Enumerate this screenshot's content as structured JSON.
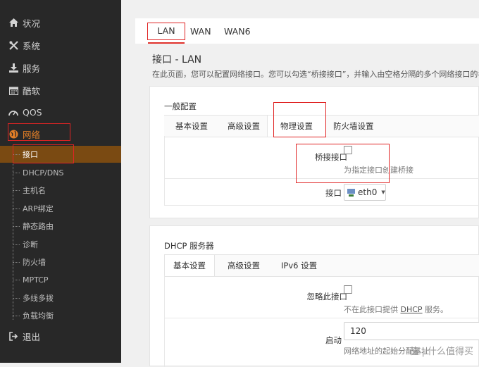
{
  "sidebar": {
    "items": [
      {
        "label": "状况",
        "icon": "home-icon"
      },
      {
        "label": "系统",
        "icon": "tools-icon"
      },
      {
        "label": "服务",
        "icon": "download-icon"
      },
      {
        "label": "酷软",
        "icon": "calendar-icon"
      },
      {
        "label": "QOS",
        "icon": "gauge-icon"
      },
      {
        "label": "网络",
        "icon": "globe-icon"
      }
    ],
    "subitems": [
      "接口",
      "DHCP/DNS",
      "主机名",
      "ARP绑定",
      "静态路由",
      "诊断",
      "防火墙",
      "MPTCP",
      "多线多拨",
      "负载均衡"
    ],
    "logout": "退出"
  },
  "top_tabs": [
    "LAN",
    "WAN",
    "WAN6"
  ],
  "section": {
    "title": "接口 - LAN",
    "description": "在此页面，您可以配置网络接口。您可以勾选“桥接接口”，并输入由空格分隔的多个网络接口的名称"
  },
  "general": {
    "title": "一般配置",
    "tabs": [
      "基本设置",
      "高级设置",
      "物理设置",
      "防火墙设置"
    ],
    "bridge_label": "桥接接口",
    "bridge_hint": "为指定接口创建桥接",
    "interface_label": "接口",
    "interface_value": "eth0"
  },
  "dhcp": {
    "title": "DHCP 服务器",
    "tabs": [
      "基本设置",
      "高级设置",
      "IPv6 设置"
    ],
    "ignore_label": "忽略此接口",
    "ignore_hint_pre": "不在此接口提供 ",
    "ignore_hint_link": "DHCP",
    "ignore_hint_post": " 服务。",
    "start_label": "启动",
    "start_value": "120",
    "start_hint": "网络地址的起始分配基址"
  },
  "watermark": "值 | 什么值得买",
  "colors": {
    "accent": "#e07e27",
    "highlight": "#e02424",
    "sidebar_bg": "#282828"
  }
}
